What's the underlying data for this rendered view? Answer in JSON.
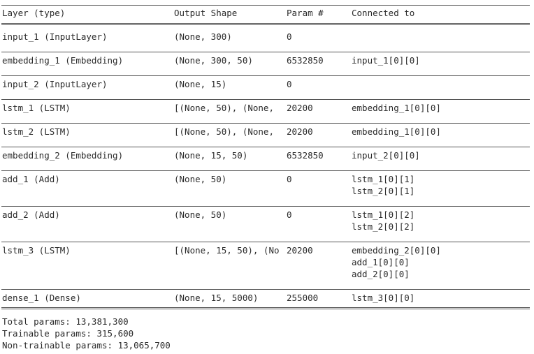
{
  "header": {
    "layer": "Layer (type)",
    "output_shape": "Output Shape",
    "param": "Param #",
    "connected_to": "Connected to"
  },
  "rows": [
    {
      "layer": "input_1 (InputLayer)",
      "shape": "(None, 300)",
      "params": "0",
      "connected": []
    },
    {
      "layer": "embedding_1 (Embedding)",
      "shape": "(None, 300, 50)",
      "params": "6532850",
      "connected": [
        "input_1[0][0]"
      ]
    },
    {
      "layer": "input_2 (InputLayer)",
      "shape": "(None, 15)",
      "params": "0",
      "connected": []
    },
    {
      "layer": "lstm_1 (LSTM)",
      "shape": "[(None, 50), (None,",
      "params": "20200",
      "connected": [
        "embedding_1[0][0]"
      ]
    },
    {
      "layer": "lstm_2 (LSTM)",
      "shape": "[(None, 50), (None,",
      "params": "20200",
      "connected": [
        "embedding_1[0][0]"
      ]
    },
    {
      "layer": "embedding_2 (Embedding)",
      "shape": "(None, 15, 50)",
      "params": "6532850",
      "connected": [
        "input_2[0][0]"
      ]
    },
    {
      "layer": "add_1 (Add)",
      "shape": "(None, 50)",
      "params": "0",
      "connected": [
        "lstm_1[0][1]",
        "lstm_2[0][1]"
      ]
    },
    {
      "layer": "add_2 (Add)",
      "shape": "(None, 50)",
      "params": "0",
      "connected": [
        "lstm_1[0][2]",
        "lstm_2[0][2]"
      ]
    },
    {
      "layer": "lstm_3 (LSTM)",
      "shape": "[(None, 15, 50), (No",
      "params": "20200",
      "connected": [
        "embedding_2[0][0]",
        "add_1[0][0]",
        "add_2[0][0]"
      ]
    },
    {
      "layer": "dense_1 (Dense)",
      "shape": "(None, 15, 5000)",
      "params": "255000",
      "connected": [
        "lstm_3[0][0]"
      ]
    }
  ],
  "summary": {
    "total": "Total params: 13,381,300",
    "trainable": "Trainable params: 315,600",
    "non_trainable": "Non-trainable params: 13,065,700"
  }
}
